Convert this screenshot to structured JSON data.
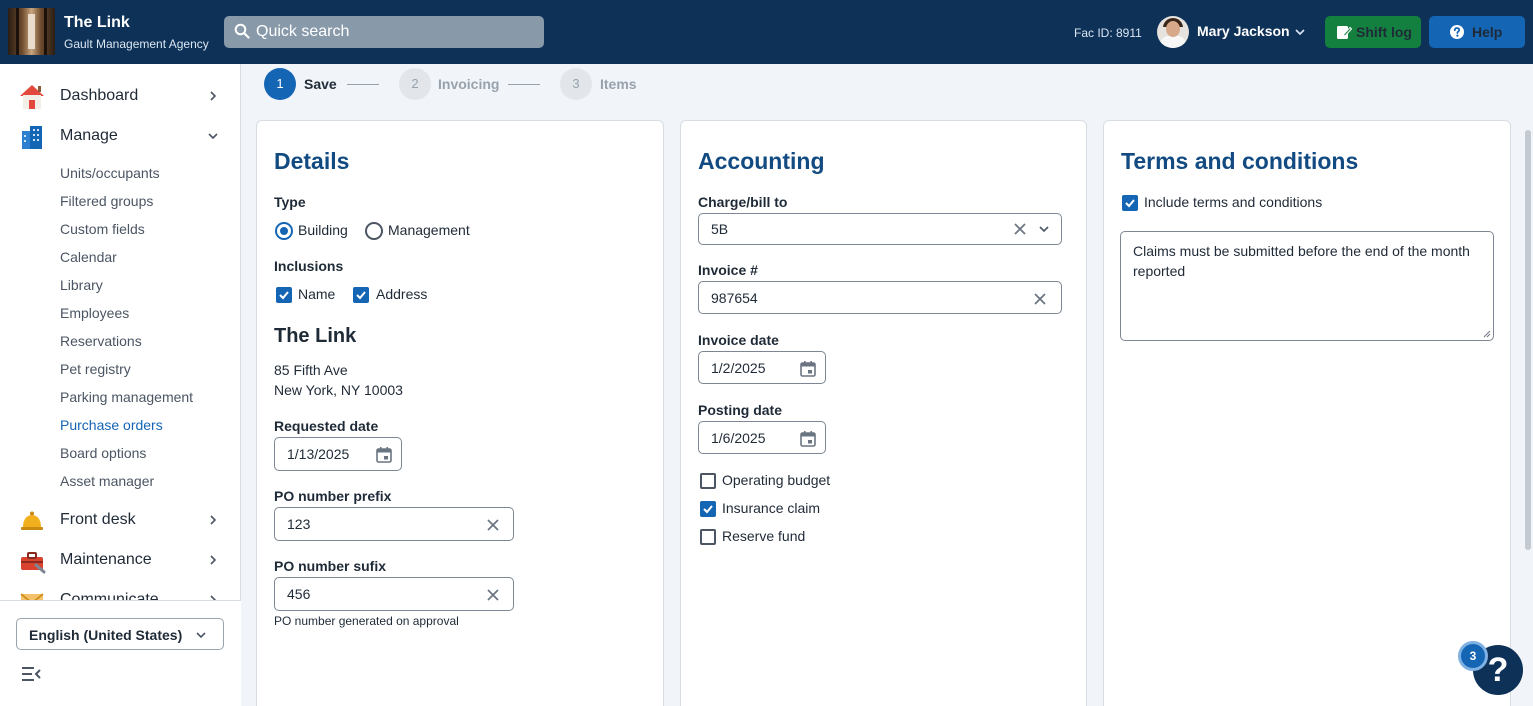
{
  "header": {
    "app_title": "The Link",
    "app_subtitle": "Gault Management Agency",
    "search_label": "Quick search",
    "fac_id": "Fac ID: 8911",
    "user_name": "Mary Jackson",
    "shift_log_label": "Shift log",
    "help_label": "Help"
  },
  "sidebar": {
    "main_items": [
      {
        "label": "Dashboard",
        "icon": "house-icon"
      },
      {
        "label": "Manage",
        "icon": "building-icon"
      },
      {
        "label": "Front desk",
        "icon": "bell-icon"
      },
      {
        "label": "Maintenance",
        "icon": "toolbox-icon"
      },
      {
        "label": "Communicate",
        "icon": "envelope-icon"
      }
    ],
    "manage_sub_items": [
      "Units/occupants",
      "Filtered groups",
      "Custom fields",
      "Calendar",
      "Library",
      "Employees",
      "Reservations",
      "Pet registry",
      "Parking management",
      "Purchase orders",
      "Board options",
      "Asset manager"
    ],
    "active_sub_item": "Purchase orders",
    "language": "English (United States)"
  },
  "stepper": [
    {
      "number": "1",
      "label": "Save",
      "active": true
    },
    {
      "number": "2",
      "label": "Invoicing",
      "active": false
    },
    {
      "number": "3",
      "label": "Items",
      "active": false
    }
  ],
  "details": {
    "title": "Details",
    "type_label": "Type",
    "type_options": [
      "Building",
      "Management"
    ],
    "type_selected": "Building",
    "inclusions_label": "Inclusions",
    "inclusions": [
      {
        "label": "Name",
        "checked": true
      },
      {
        "label": "Address",
        "checked": true
      }
    ],
    "building_name": "The Link",
    "address_line1": "85 Fifth Ave",
    "address_line2": "New York, NY 10003",
    "requested_date_label": "Requested date",
    "requested_date": "1/13/2025",
    "prefix_label": "PO number prefix",
    "prefix_value": "123",
    "sufix_label": "PO number sufix",
    "sufix_value": "456",
    "po_hint": "PO number generated on approval"
  },
  "accounting": {
    "title": "Accounting",
    "charge_label": "Charge/bill to",
    "charge_value": "5B",
    "invoice_no_label": "Invoice #",
    "invoice_no_value": "987654",
    "invoice_date_label": "Invoice date",
    "invoice_date_value": "1/2/2025",
    "posting_date_label": "Posting date",
    "posting_date_value": "1/6/2025",
    "flags": [
      {
        "label": "Operating budget",
        "checked": false
      },
      {
        "label": "Insurance claim",
        "checked": true
      },
      {
        "label": "Reserve fund",
        "checked": false
      }
    ]
  },
  "terms": {
    "title": "Terms and conditions",
    "include_label": "Include terms and conditions",
    "include_checked": true,
    "text": "Claims must be submitted before the end of the month reported"
  },
  "help_fab": {
    "symbol": "?",
    "badge_count": "3"
  },
  "colors": {
    "header_bg": "#0d3157",
    "accent": "#1565b5",
    "shift_log_bg": "#14803f",
    "heading": "#124b82"
  }
}
